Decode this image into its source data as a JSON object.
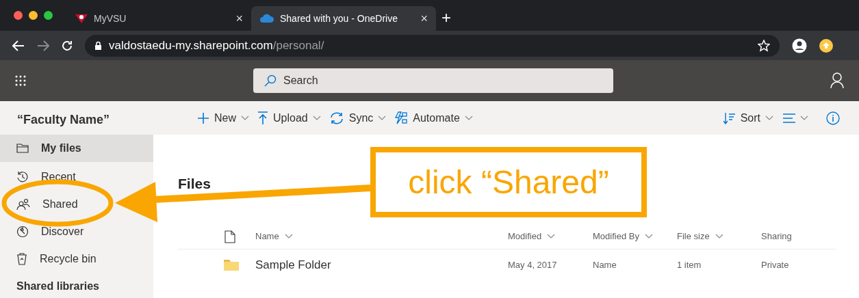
{
  "browser": {
    "tabs": [
      {
        "title": "MyVSU",
        "selected": false,
        "close": "×"
      },
      {
        "title": "Shared with you - OneDrive",
        "selected": true,
        "close": "×"
      }
    ],
    "new_tab": "+",
    "url_host": "valdostaedu-my.sharepoint.com",
    "url_path": "/personal/"
  },
  "suite_bar": {
    "search": {
      "placeholder": "Search"
    }
  },
  "sidebar": {
    "title": "“Faculty Name”",
    "items": [
      {
        "label": "My files",
        "selected": true,
        "kind": "folder"
      },
      {
        "label": "Recent",
        "selected": false,
        "kind": "recent"
      },
      {
        "label": "Shared",
        "selected": false,
        "kind": "shared"
      },
      {
        "label": "Discover",
        "selected": false,
        "kind": "discover"
      },
      {
        "label": "Recycle bin",
        "selected": false,
        "kind": "bin"
      }
    ],
    "section": "Shared libraries"
  },
  "command_bar": {
    "left": [
      {
        "label": "New",
        "kind": "new"
      },
      {
        "label": "Upload",
        "kind": "upload"
      },
      {
        "label": "Sync",
        "kind": "sync"
      },
      {
        "label": "Automate",
        "kind": "automate"
      }
    ],
    "sort": "Sort"
  },
  "main": {
    "title": "Files",
    "table": {
      "columns": [
        "Name",
        "Modified",
        "Modified By",
        "File size",
        "Sharing"
      ],
      "rows": [
        {
          "name": "Sample Folder",
          "modified": "May 4, 2017",
          "modified_by": "Name",
          "file_size": "1 item",
          "sharing": "Private"
        }
      ]
    }
  },
  "callout": {
    "text": "click “Shared”"
  }
}
